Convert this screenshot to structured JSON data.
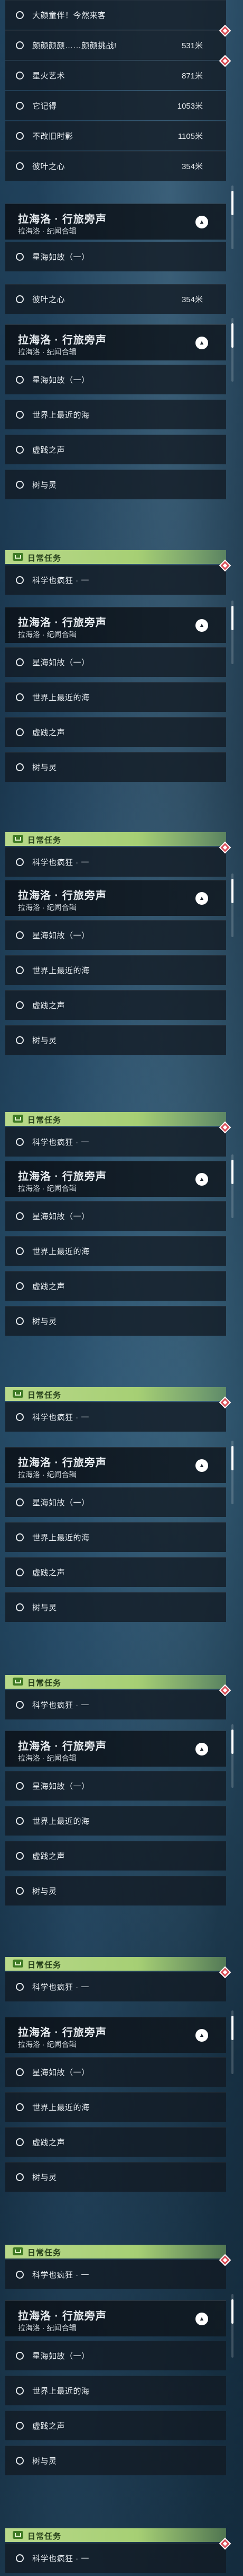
{
  "top_list": [
    {
      "label": "大颜童伴！今然来客",
      "distance": ""
    },
    {
      "label": "颜颜颜颜……颜颜挑战!",
      "distance": "531米"
    },
    {
      "label": "星火艺术",
      "distance": "871米"
    },
    {
      "label": "它记得",
      "distance": "1053米"
    },
    {
      "label": "不改旧时影",
      "distance": "1105米"
    },
    {
      "label": "彼叶之心",
      "distance": "354米"
    }
  ],
  "first_section": {
    "title": "拉海洛 · 行旅旁声",
    "subtitle": "拉海洛 · 纪闻合辑",
    "collapse_icon": "▲",
    "items": [
      {
        "label": "星海如故（一）"
      },
      {
        "label": "彼叶之心",
        "distance": "354米"
      }
    ]
  },
  "section": {
    "title": "拉海洛 · 行旅旁声",
    "subtitle": "拉海洛 · 纪闻合辑",
    "collapse_icon": "▲",
    "items": [
      {
        "label": "星海如故（一）"
      },
      {
        "label": "世界上最近的海"
      },
      {
        "label": "虚践之声"
      },
      {
        "label": "树与灵"
      }
    ]
  },
  "daily": {
    "label": "日常任务",
    "item": "科学也疯狂 · 一"
  },
  "colors": {
    "daily_band": "#a6cf74",
    "marker_red": "#d84b55",
    "panel": "#121a22"
  }
}
